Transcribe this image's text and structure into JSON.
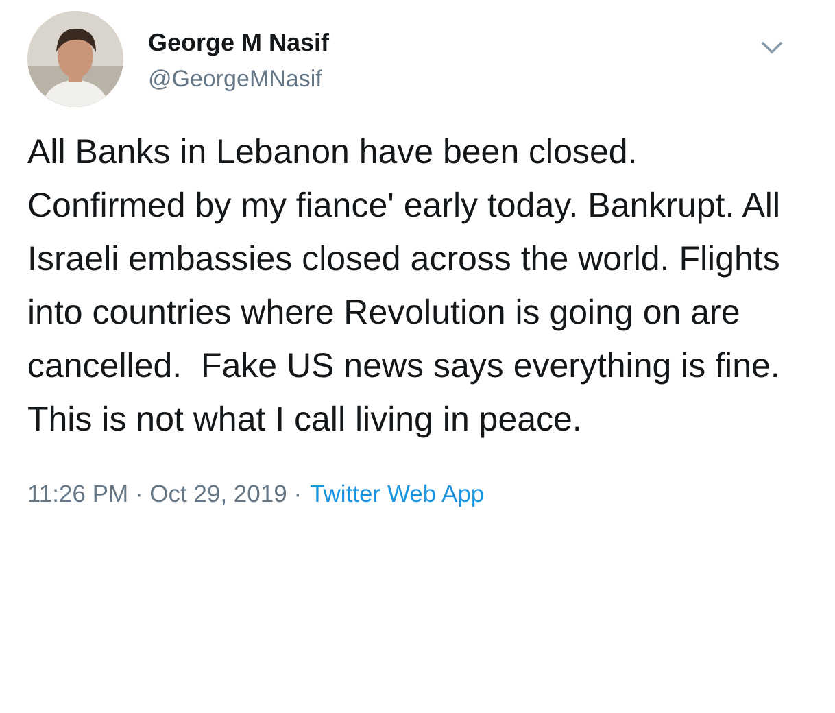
{
  "author": {
    "name": "George M Nasif",
    "handle": "@GeorgeMNasif"
  },
  "tweet": {
    "text": "All Banks in Lebanon have been closed. Confirmed by my fiance' early today. Bankrupt. All Israeli embassies closed across the world. Flights into countries where Revolution is going on are cancelled.  Fake US news says everything is fine. This is not what I call living in peace."
  },
  "footer": {
    "meta": "11:26 PM · Oct 29, 2019 ·",
    "source": "Twitter Web App"
  }
}
